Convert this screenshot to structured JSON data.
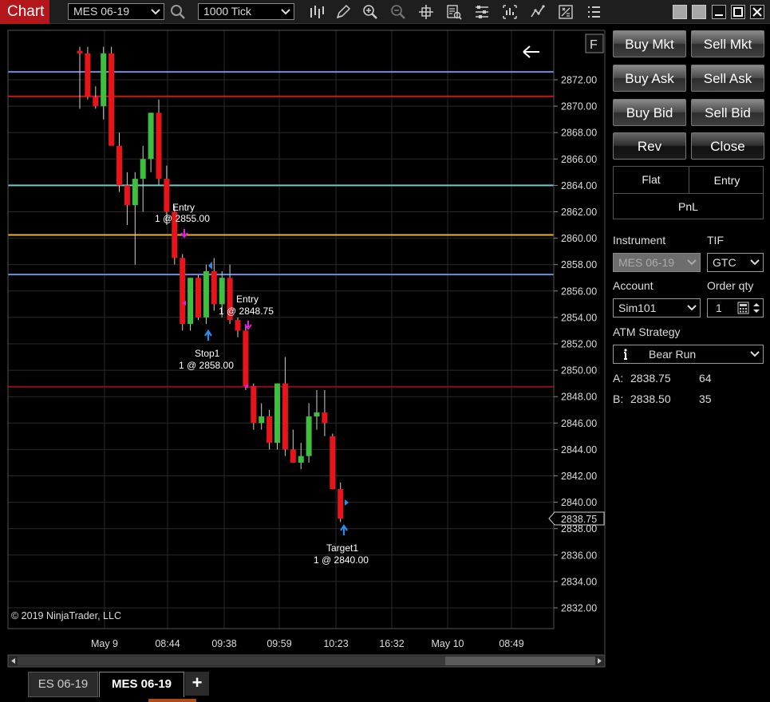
{
  "app": {
    "title": "Chart"
  },
  "toolbar": {
    "instrument": "MES 06-19",
    "interval": "1000 Tick"
  },
  "chart": {
    "copyright": "© 2019 NinjaTrader, LLC",
    "flat_marker": "F",
    "price_axis": {
      "min": 2831,
      "max": 2874,
      "labels": [
        "2872.00",
        "2870.00",
        "2868.00",
        "2866.00",
        "2864.00",
        "2862.00",
        "2860.00",
        "2858.00",
        "2856.00",
        "2854.00",
        "2852.00",
        "2850.00",
        "2848.00",
        "2846.00",
        "2844.00",
        "2842.00",
        "2840.00",
        "2838.00",
        "2836.00",
        "2834.00",
        "2832.00"
      ]
    },
    "last_price": "2838.75",
    "time_labels": [
      "May 9",
      "08:44",
      "09:38",
      "09:59",
      "10:23",
      "16:32",
      "May 10",
      "08:49"
    ],
    "horizontal_lines": [
      {
        "price": 2872.6,
        "color": "#6f8fe6"
      },
      {
        "price": 2870.75,
        "color": "#d0141a"
      },
      {
        "price": 2864.0,
        "color": "#66cccc"
      },
      {
        "price": 2860.25,
        "color": "#f0b423"
      },
      {
        "price": 2857.25,
        "color": "#6f8fe6"
      },
      {
        "price": 2848.75,
        "color": "#8c1015"
      }
    ],
    "annotations": [
      {
        "title": "Entry",
        "detail": "1 @ 2855.00"
      },
      {
        "title": "Entry",
        "detail": "1 @ 2848.75"
      },
      {
        "title": "Stop1",
        "detail": "1 @ 2858.00"
      },
      {
        "title": "Target1",
        "detail": "1 @ 2840.00"
      }
    ],
    "colors": {
      "up": "#3fbf3f",
      "down": "#e8141a",
      "wick": "#cfcfcf",
      "grid": "#2a2a2a",
      "sell_marker": "#e020e0",
      "buy_marker": "#2d8ce8"
    }
  },
  "chart_data": {
    "type": "candlestick",
    "candles": [
      {
        "o": 2874.2,
        "h": 2874.5,
        "l": 2869.8,
        "c": 2874.0
      },
      {
        "o": 2874.0,
        "h": 2874.5,
        "l": 2870.5,
        "c": 2870.7
      },
      {
        "o": 2870.7,
        "h": 2871.5,
        "l": 2869.8,
        "c": 2870.0
      },
      {
        "o": 2870.0,
        "h": 2874.5,
        "l": 2869.0,
        "c": 2874.0
      },
      {
        "o": 2874.0,
        "h": 2874.5,
        "l": 2868.5,
        "c": 2867.0
      },
      {
        "o": 2867.0,
        "h": 2868.0,
        "l": 2863.5,
        "c": 2864.0
      },
      {
        "o": 2864.0,
        "h": 2865.0,
        "l": 2861.0,
        "c": 2862.5
      },
      {
        "o": 2862.5,
        "h": 2865.0,
        "l": 2858.0,
        "c": 2864.5
      },
      {
        "o": 2864.5,
        "h": 2867.0,
        "l": 2862.0,
        "c": 2866.0
      },
      {
        "o": 2866.0,
        "h": 2869.5,
        "l": 2865.0,
        "c": 2869.5
      },
      {
        "o": 2869.5,
        "h": 2870.5,
        "l": 2864.0,
        "c": 2864.5
      },
      {
        "o": 2864.5,
        "h": 2865.5,
        "l": 2861.0,
        "c": 2862.0
      },
      {
        "o": 2862.0,
        "h": 2862.5,
        "l": 2858.0,
        "c": 2858.5
      },
      {
        "o": 2858.5,
        "h": 2858.8,
        "l": 2853.0,
        "c": 2853.5
      },
      {
        "o": 2853.5,
        "h": 2857.0,
        "l": 2853.0,
        "c": 2857.0
      },
      {
        "o": 2857.0,
        "h": 2857.2,
        "l": 2853.8,
        "c": 2854.0
      },
      {
        "o": 2854.0,
        "h": 2858.0,
        "l": 2853.5,
        "c": 2857.5
      },
      {
        "o": 2857.5,
        "h": 2858.5,
        "l": 2854.5,
        "c": 2855.0
      },
      {
        "o": 2855.0,
        "h": 2857.5,
        "l": 2854.0,
        "c": 2857.0
      },
      {
        "o": 2857.0,
        "h": 2858.0,
        "l": 2853.5,
        "c": 2853.8
      },
      {
        "o": 2853.8,
        "h": 2854.0,
        "l": 2852.5,
        "c": 2853.0
      },
      {
        "o": 2853.0,
        "h": 2853.5,
        "l": 2848.5,
        "c": 2848.8
      },
      {
        "o": 2848.8,
        "h": 2849.0,
        "l": 2845.5,
        "c": 2846.0
      },
      {
        "o": 2846.0,
        "h": 2847.5,
        "l": 2845.5,
        "c": 2846.5
      },
      {
        "o": 2846.5,
        "h": 2847.0,
        "l": 2844.0,
        "c": 2844.5
      },
      {
        "o": 2844.5,
        "h": 2849.0,
        "l": 2844.0,
        "c": 2849.0
      },
      {
        "o": 2849.0,
        "h": 2851.0,
        "l": 2843.5,
        "c": 2844.0
      },
      {
        "o": 2844.0,
        "h": 2845.5,
        "l": 2843.0,
        "c": 2843.0
      },
      {
        "o": 2843.0,
        "h": 2844.5,
        "l": 2842.5,
        "c": 2843.5
      },
      {
        "o": 2843.5,
        "h": 2847.5,
        "l": 2843.0,
        "c": 2846.5
      },
      {
        "o": 2846.5,
        "h": 2848.5,
        "l": 2845.5,
        "c": 2846.8
      },
      {
        "o": 2846.8,
        "h": 2848.5,
        "l": 2845.0,
        "c": 2846.0
      },
      {
        "o": 2845.0,
        "h": 2845.2,
        "l": 2841.0,
        "c": 2841.0
      },
      {
        "o": 2841.0,
        "h": 2841.5,
        "l": 2838.5,
        "c": 2838.75
      }
    ]
  },
  "order_panel": {
    "buttons": {
      "buy_mkt": "Buy Mkt",
      "sell_mkt": "Sell Mkt",
      "buy_ask": "Buy Ask",
      "sell_ask": "Sell Ask",
      "buy_bid": "Buy Bid",
      "sell_bid": "Sell Bid",
      "rev": "Rev",
      "close": "Close"
    },
    "position": {
      "status": "Flat",
      "entry": "Entry",
      "pnl": "PnL"
    },
    "instrument_label": "Instrument",
    "instrument_value": "MES 06-19",
    "tif_label": "TIF",
    "tif_value": "GTC",
    "account_label": "Account",
    "account_value": "Sim101",
    "qty_label": "Order qty",
    "qty_value": "1",
    "atm_label": "ATM Strategy",
    "atm_value": "Bear Run",
    "ask": {
      "label": "A:",
      "price": "2838.75",
      "size": "64"
    },
    "bid": {
      "label": "B:",
      "price": "2838.50",
      "size": "35"
    }
  },
  "tabs": [
    {
      "label": "ES 06-19",
      "active": false
    },
    {
      "label": "MES 06-19",
      "active": true
    }
  ],
  "tab_add": "+"
}
